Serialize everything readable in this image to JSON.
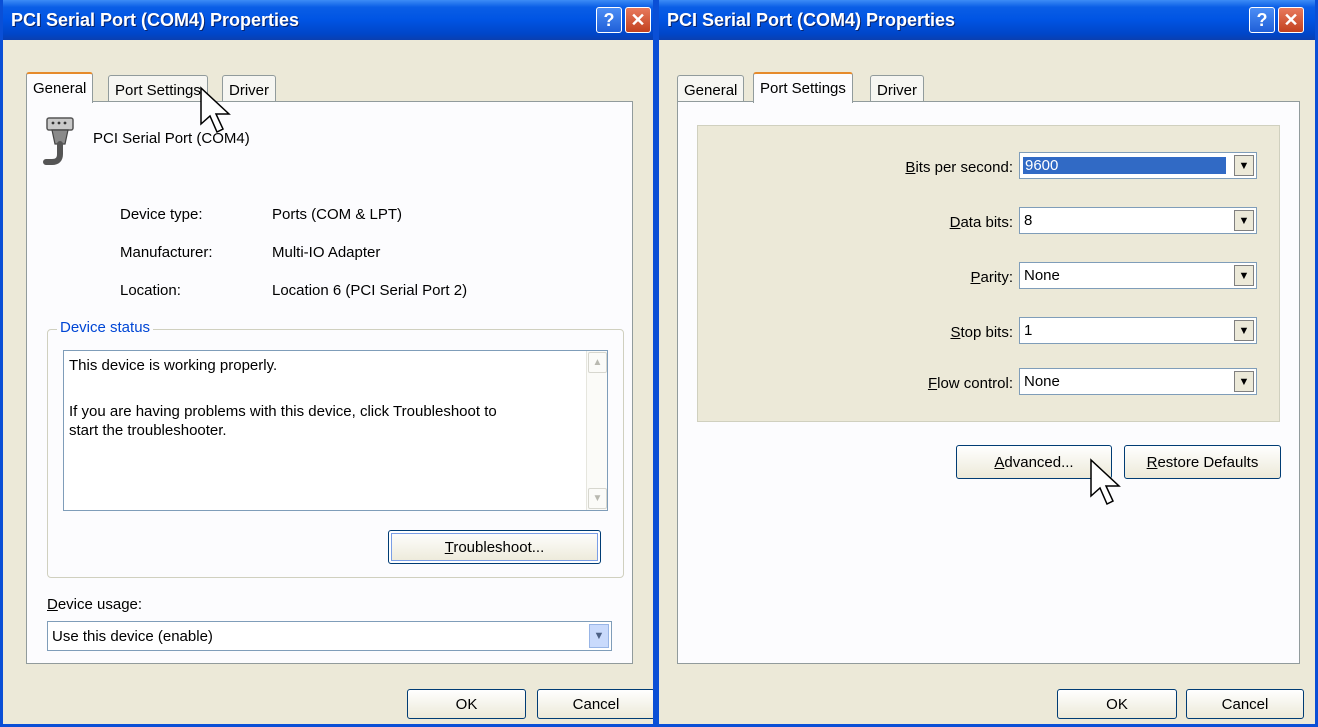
{
  "left_dialog": {
    "title": "PCI Serial Port (COM4) Properties",
    "help_glyph": "?",
    "close_glyph": "✕",
    "tabs": [
      "General",
      "Port Settings",
      "Driver"
    ],
    "active_tab": "General",
    "device_name": "PCI Serial Port (COM4)",
    "device_icon": "serial-port-icon",
    "info": {
      "device_type_label": "Device type:",
      "device_type_value": "Ports (COM & LPT)",
      "manufacturer_label": "Manufacturer:",
      "manufacturer_value": "Multi-IO Adapter",
      "location_label": "Location:",
      "location_value": "Location 6 (PCI Serial Port 2)"
    },
    "device_status": {
      "label": "Device status",
      "line1": "This device is working properly.",
      "line2": "If you are having problems with this device, click Troubleshoot to",
      "line3": "start the troubleshooter."
    },
    "troubleshoot": {
      "first": "T",
      "rest": "roubleshoot..."
    },
    "device_usage": {
      "label_first": "D",
      "label_rest": "evice usage:",
      "value": "Use this device (enable)"
    },
    "ok_label": "OK",
    "cancel_label": "Cancel"
  },
  "right_dialog": {
    "title": "PCI Serial Port (COM4) Properties",
    "help_glyph": "?",
    "close_glyph": "✕",
    "tabs": [
      "General",
      "Port Settings",
      "Driver"
    ],
    "active_tab": "Port Settings",
    "settings": {
      "bits_first": "B",
      "bits_rest": "its per second:",
      "bits_value": "9600",
      "data_first": "D",
      "data_rest": "ata bits:",
      "data_value": "8",
      "parity_first": "P",
      "parity_rest": "arity:",
      "parity_value": "None",
      "stop_first": "S",
      "stop_rest": "top bits:",
      "stop_value": "1",
      "flow_first": "F",
      "flow_rest": "low control:",
      "flow_value": "None"
    },
    "advanced": {
      "first": "A",
      "rest": "dvanced..."
    },
    "restore": {
      "first": "R",
      "rest": "estore Defaults"
    },
    "ok_label": "OK",
    "cancel_label": "Cancel"
  },
  "colors": {
    "titlebar": "#0054e3",
    "dialog_face": "#ece9d8",
    "selection": "#316ac5",
    "active_tab_accent": "#e68b2c",
    "group_label": "#0046d5"
  }
}
